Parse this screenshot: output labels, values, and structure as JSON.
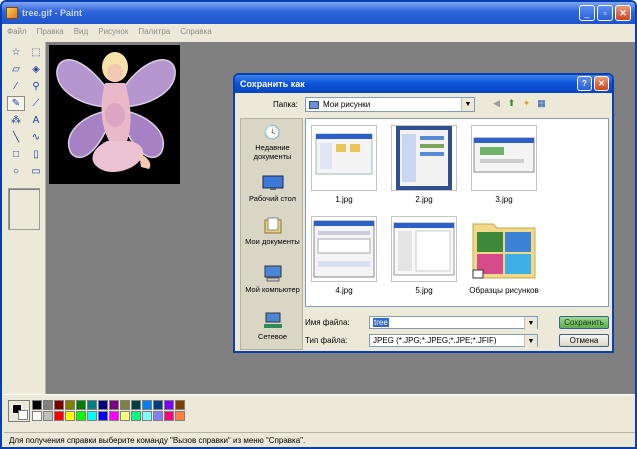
{
  "window": {
    "title": "tree.gif - Paint",
    "min_label": "_",
    "max_label": "▫",
    "close_label": "✕"
  },
  "menu": [
    {
      "label": "Файл"
    },
    {
      "label": "Правка"
    },
    {
      "label": "Вид"
    },
    {
      "label": "Рисунок"
    },
    {
      "label": "Палитра"
    },
    {
      "label": "Справка"
    }
  ],
  "tools": [
    {
      "icon": "free-select-icon",
      "glyph": "☆"
    },
    {
      "icon": "rect-select-icon",
      "glyph": "⬚"
    },
    {
      "icon": "eraser-icon",
      "glyph": "▱"
    },
    {
      "icon": "fill-icon",
      "glyph": "◈"
    },
    {
      "icon": "picker-icon",
      "glyph": "⁄"
    },
    {
      "icon": "magnifier-icon",
      "glyph": "⚲"
    },
    {
      "icon": "pencil-icon",
      "glyph": "✎"
    },
    {
      "icon": "brush-icon",
      "glyph": "⟋"
    },
    {
      "icon": "airbrush-icon",
      "glyph": "⁂"
    },
    {
      "icon": "text-icon",
      "glyph": "A"
    },
    {
      "icon": "line-icon",
      "glyph": "╲"
    },
    {
      "icon": "curve-icon",
      "glyph": "∿"
    },
    {
      "icon": "rectangle-icon",
      "glyph": "□"
    },
    {
      "icon": "polygon-icon",
      "glyph": "▯"
    },
    {
      "icon": "ellipse-icon",
      "glyph": "○"
    },
    {
      "icon": "rounded-rect-icon",
      "glyph": "▭"
    }
  ],
  "palette": [
    "#000000",
    "#808080",
    "#800000",
    "#808000",
    "#008000",
    "#008080",
    "#000080",
    "#800080",
    "#808040",
    "#004040",
    "#0080ff",
    "#004080",
    "#8000ff",
    "#804000",
    "#ffffff",
    "#c0c0c0",
    "#ff0000",
    "#ffff00",
    "#00ff00",
    "#00ffff",
    "#0000ff",
    "#ff00ff",
    "#ffff80",
    "#00ff80",
    "#80ffff",
    "#8080ff",
    "#ff0080",
    "#ff8040"
  ],
  "status": "Для получения справки выберите команду \"Вызов справки\" из меню \"Справка\".",
  "dialog": {
    "title": "Сохранить как",
    "help_label": "?",
    "close_label": "✕",
    "folder_label": "Папка:",
    "folder_value": "Мои рисунки",
    "places": [
      {
        "label": "Недавние документы",
        "icon": "recent-documents-icon"
      },
      {
        "label": "Рабочий стол",
        "icon": "desktop-icon"
      },
      {
        "label": "Мои документы",
        "icon": "my-documents-icon"
      },
      {
        "label": "Мой компьютер",
        "icon": "my-computer-icon"
      },
      {
        "label": "Сетевое",
        "icon": "network-icon"
      }
    ],
    "files": [
      {
        "name": "1.jpg"
      },
      {
        "name": "2.jpg"
      },
      {
        "name": "3.jpg"
      },
      {
        "name": "4.jpg"
      },
      {
        "name": "5.jpg"
      },
      {
        "name": "Образцы рисунков"
      }
    ],
    "filename_label": "Имя файла:",
    "filename_value": "tree",
    "filetype_label": "Тип файла:",
    "filetype_value": "JPEG (*.JPG;*.JPEG;*.JPE;*.JFIF)",
    "save_label": "Сохранить",
    "cancel_label": "Отмена"
  }
}
